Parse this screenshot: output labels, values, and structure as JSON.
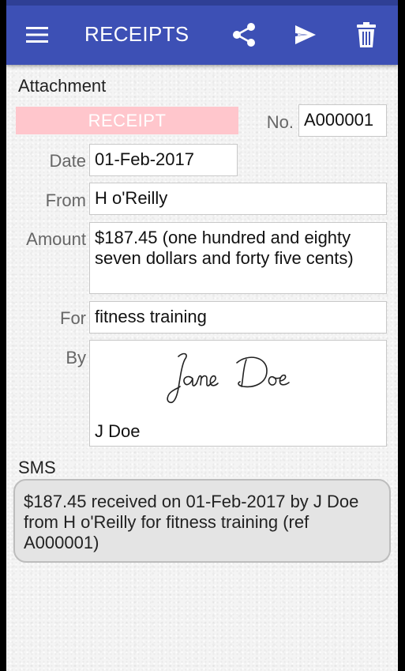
{
  "app_bar": {
    "title": "RECEIPTS",
    "icons": [
      "menu-icon",
      "share-icon",
      "send-icon",
      "trash-icon"
    ],
    "color": "#3d50b5"
  },
  "attachment": {
    "heading": "Attachment",
    "receipt_button": "RECEIPT",
    "receipt_button_color": "#ffc6cc"
  },
  "form": {
    "no_label": "No.",
    "no_value": "A000001",
    "date_label": "Date",
    "date_value": "01-Feb-2017",
    "from_label": "From",
    "from_value": "H o'Reilly",
    "amount_label": "Amount",
    "amount_value": "$187.45 (one hundred and eighty seven dollars and forty five cents)",
    "for_label": "For",
    "for_value": "fitness training",
    "by_label": "By",
    "signature_text": "Jane Doe",
    "by_name": "J Doe"
  },
  "sms": {
    "heading": "SMS",
    "message": "$187.45 received on 01-Feb-2017 by J Doe from H o'Reilly for fitness training (ref A000001)"
  }
}
